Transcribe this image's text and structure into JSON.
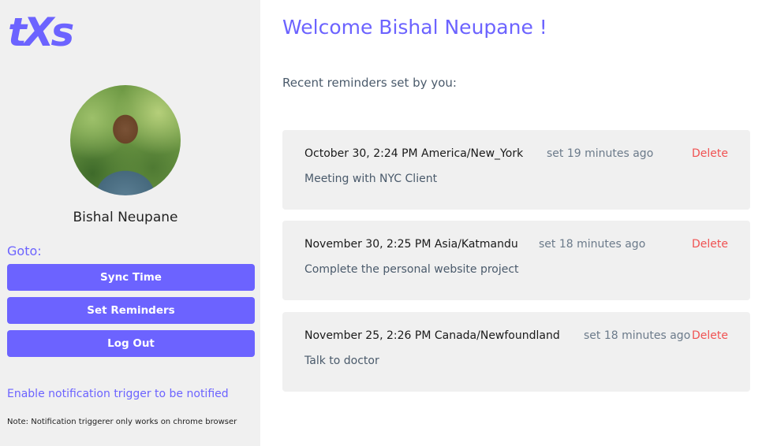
{
  "brand": {
    "logo_text": "tXs",
    "accent_color": "#6c63ff"
  },
  "profile": {
    "name": "Bishal Neupane",
    "avatar": "profile-photo"
  },
  "nav": {
    "heading": "Goto:",
    "buttons": [
      {
        "label": "Sync Time"
      },
      {
        "label": "Set Reminders"
      },
      {
        "label": "Log Out"
      }
    ]
  },
  "notifications": {
    "link_text": "Enable notification trigger to be notified",
    "note": "Note: Notification triggerer only works on chrome browser"
  },
  "main": {
    "welcome": "Welcome Bishal Neupane !",
    "reminders_title": "Recent reminders set by you:",
    "reminders": [
      {
        "when": "October 30, 2:24 PM America/New_York",
        "ago": "set 19 minutes ago",
        "delete_label": "Delete",
        "message": "Meeting with NYC Client"
      },
      {
        "when": "November 30, 2:25 PM Asia/Katmandu",
        "ago": "set 18 minutes ago",
        "delete_label": "Delete",
        "message": "Complete the personal website project"
      },
      {
        "when": "November 25, 2:26 PM Canada/Newfoundland",
        "ago": "set 18 minutes ago",
        "delete_label": "Delete",
        "message": "Talk to doctor"
      }
    ]
  },
  "colors": {
    "delete": "#f05252",
    "sidebar_bg": "#f0f0f0",
    "card_bg": "#f0f0f0"
  }
}
